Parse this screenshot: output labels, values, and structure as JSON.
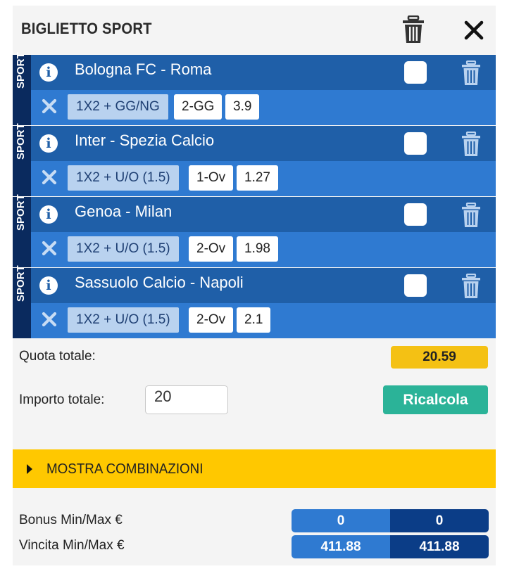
{
  "header": {
    "title": "BIGLIETTO SPORT"
  },
  "tickets": [
    {
      "side_label": "SPORT",
      "match": "Bologna FC - Roma",
      "market": "1X2 + GG/NG",
      "pick": "2-GG",
      "odds": "3.9"
    },
    {
      "side_label": "SPORT",
      "match": "Inter - Spezia Calcio",
      "market": "1X2 + U/O (1.5)",
      "pick": "1-Ov",
      "odds": "1.27"
    },
    {
      "side_label": "SPORT",
      "match": "Genoa - Milan",
      "market": "1X2 + U/O (1.5)",
      "pick": "2-Ov",
      "odds": "1.98"
    },
    {
      "side_label": "SPORT",
      "match": "Sassuolo Calcio - Napoli",
      "market": "1X2 + U/O (1.5)",
      "pick": "2-Ov",
      "odds": "2.1"
    }
  ],
  "totals": {
    "quota_label": "Quota totale:",
    "quota_value": "20.59",
    "importo_label": "Importo totale:",
    "importo_value": "20",
    "ricalcola_label": "Ricalcola"
  },
  "combinazioni": {
    "label": "MOSTRA COMBINAZIONI"
  },
  "summary": {
    "bonus_label": "Bonus Min/Max €",
    "bonus_min": "0",
    "bonus_max": "0",
    "vincita_label": "Vincita Min/Max €",
    "vincita_min": "411.88",
    "vincita_max": "411.88"
  },
  "colors": {
    "header_row": "#1f5fa8",
    "sub_row": "#2f7ad1",
    "side_strip": "#0a2a5e",
    "quota_accent": "#f4c114",
    "ricalcola": "#2bb398",
    "combinazioni_bar": "#ffc800"
  },
  "icons": {
    "header_delete": "trash-icon",
    "close": "close-icon",
    "info": "info-icon",
    "remove": "x-icon",
    "row_delete": "trash-icon",
    "expand": "caret-right-icon"
  }
}
